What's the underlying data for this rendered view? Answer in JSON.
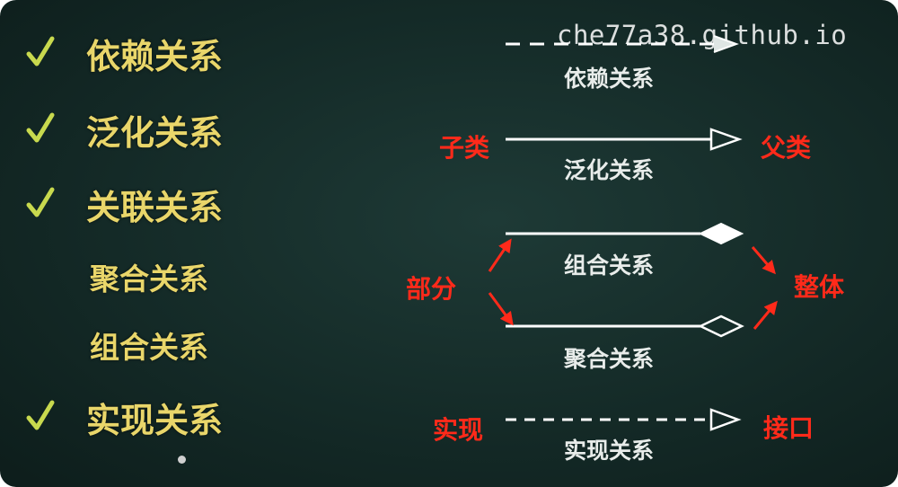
{
  "watermark": "che77a38.github.io",
  "left_list": [
    {
      "label": "依赖关系",
      "checked": true
    },
    {
      "label": "泛化关系",
      "checked": true
    },
    {
      "label": "关联关系",
      "checked": true
    },
    {
      "label": "聚合关系",
      "checked": false
    },
    {
      "label": "组合关系",
      "checked": false
    },
    {
      "label": "实现关系",
      "checked": true
    }
  ],
  "diagram": {
    "dependency": {
      "caption": "依赖关系",
      "line": "dashed",
      "arrow": "open-triangle"
    },
    "generalization": {
      "caption": "泛化关系",
      "from": "子类",
      "to": "父类",
      "line": "solid",
      "arrow": "hollow-triangle"
    },
    "composition": {
      "caption": "组合关系",
      "line": "solid",
      "end": "filled-diamond"
    },
    "aggregation": {
      "caption": "聚合关系",
      "line": "solid",
      "end": "hollow-diamond"
    },
    "part_label": "部分",
    "whole_label": "整体",
    "realization": {
      "caption": "实现关系",
      "from": "实现",
      "to": "接口",
      "line": "dashed",
      "arrow": "hollow-triangle"
    }
  },
  "colors": {
    "background": "#142a27",
    "list_text": "#e9d66a",
    "check": "#c8d94e",
    "line": "#ffffff",
    "annotation": "#ff2a1a"
  }
}
